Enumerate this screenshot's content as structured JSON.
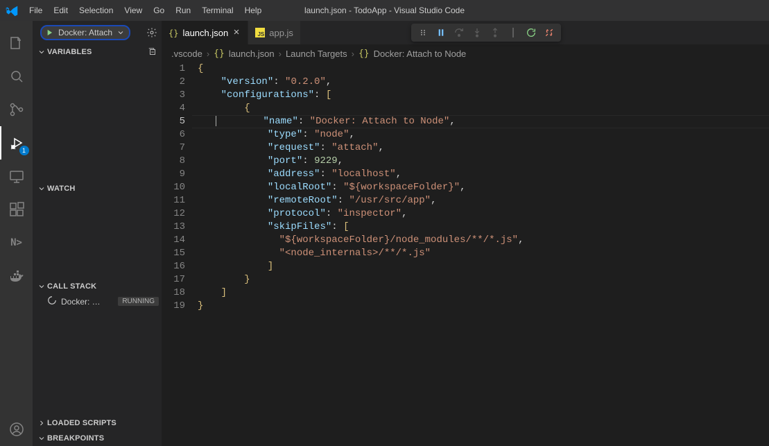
{
  "menu": {
    "items": [
      "File",
      "Edit",
      "Selection",
      "View",
      "Go",
      "Run",
      "Terminal",
      "Help"
    ],
    "title": "launch.json - TodoApp - Visual Studio Code"
  },
  "activity": {
    "debug_badge": "1"
  },
  "side": {
    "launch_label": "Docker: Attach",
    "sections": {
      "variables": "VARIABLES",
      "watch": "WATCH",
      "callstack": "CALL STACK",
      "loaded": "LOADED SCRIPTS",
      "breakpoints": "BREAKPOINTS"
    },
    "callstack_item": "Docker: …",
    "callstack_status": "RUNNING"
  },
  "tabs": {
    "launch": "launch.json",
    "app": "app.js"
  },
  "breadcrumbs": {
    "seg0": ".vscode",
    "seg1": "launch.json",
    "seg2": "Launch Targets",
    "seg3": "Docker: Attach to Node"
  },
  "code": {
    "line_numbers": [
      "1",
      "2",
      "3",
      "4",
      "5",
      "6",
      "7",
      "8",
      "9",
      "10",
      "11",
      "12",
      "13",
      "14",
      "15",
      "16",
      "17",
      "18",
      "19"
    ],
    "l1": "{",
    "l2k": "\"version\"",
    "l2v": "\"0.2.0\"",
    "l3k": "\"configurations\"",
    "l5k": "\"name\"",
    "l5v": "\"Docker: Attach to Node\"",
    "l6k": "\"type\"",
    "l6v": "\"node\"",
    "l7k": "\"request\"",
    "l7v": "\"attach\"",
    "l8k": "\"port\"",
    "l8v": "9229",
    "l9k": "\"address\"",
    "l9v": "\"localhost\"",
    "l10k": "\"localRoot\"",
    "l10v": "\"${workspaceFolder}\"",
    "l11k": "\"remoteRoot\"",
    "l11v": "\"/usr/src/app\"",
    "l12k": "\"protocol\"",
    "l12v": "\"inspector\"",
    "l13k": "\"skipFiles\"",
    "l14": "\"${workspaceFolder}/node_modules/**/*.js\"",
    "l15": "\"<node_internals>/**/*.js\""
  }
}
